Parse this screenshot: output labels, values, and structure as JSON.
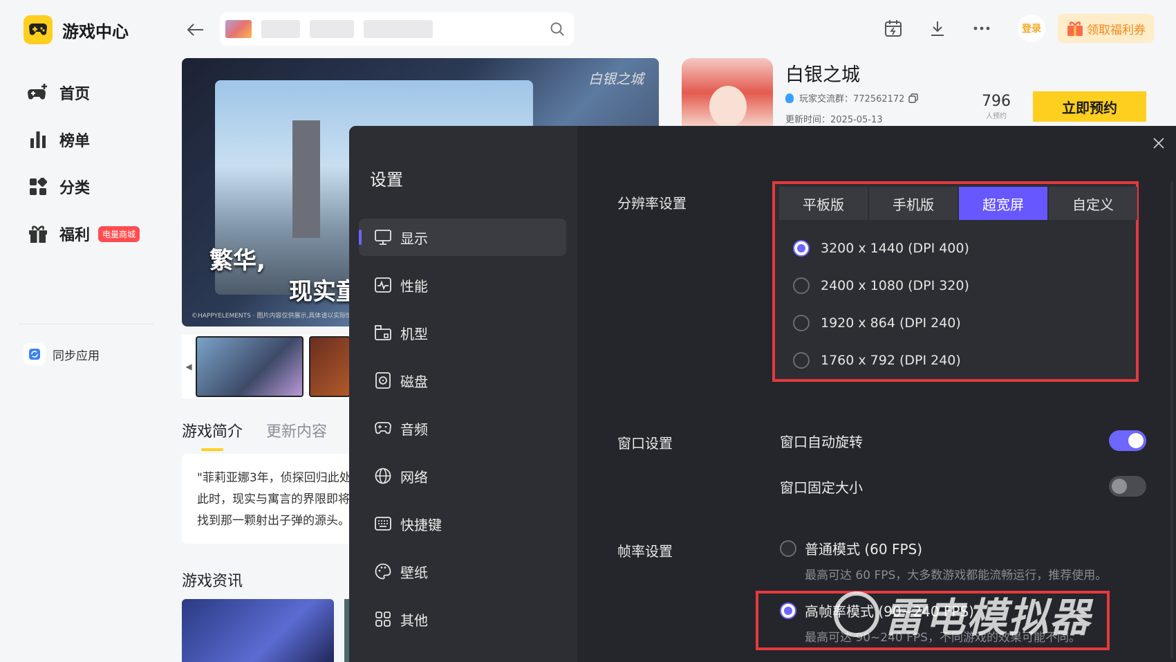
{
  "app": {
    "title": "游戏中心"
  },
  "nav": [
    {
      "label": "首页",
      "icon": "gamepad-plus-icon"
    },
    {
      "label": "榜单",
      "icon": "bar-chart-icon"
    },
    {
      "label": "分类",
      "icon": "grid-icon"
    },
    {
      "label": "福利",
      "icon": "gift-icon",
      "badge": "电量商城"
    }
  ],
  "sync": {
    "label": "同步应用"
  },
  "topbar": {
    "login": "登录",
    "welfare": "领取福利券"
  },
  "banner": {
    "title1": "繁华,",
    "title2": "现实童",
    "logo": "白银之城",
    "copyright": "©HAPPYELEMENTS · 图片内容仅供展示,具体请以实际情况为准"
  },
  "game": {
    "name": "白银之城",
    "qq_group": "玩家交流群：772562172",
    "updated": "更新时间：2025-05-13",
    "reservations": "796",
    "reservations_label": "人预约",
    "reserve_button": "立即预约"
  },
  "game_tabs": {
    "intro": "游戏简介",
    "updates": "更新内容"
  },
  "description": {
    "line1": "\"菲莉亚娜3年，侦探回归此处",
    "line2": "此时，现实与寓言的界限即将",
    "line3": "找到那一颗射出子弹的源头。"
  },
  "news": {
    "title": "游戏资讯"
  },
  "settings": {
    "title": "设置",
    "menu": [
      {
        "label": "显示",
        "icon": "monitor-icon",
        "active": true
      },
      {
        "label": "性能",
        "icon": "performance-icon"
      },
      {
        "label": "机型",
        "icon": "device-model-icon"
      },
      {
        "label": "磁盘",
        "icon": "disk-icon"
      },
      {
        "label": "音频",
        "icon": "audio-gamepad-icon"
      },
      {
        "label": "网络",
        "icon": "globe-icon"
      },
      {
        "label": "快捷键",
        "icon": "keyboard-icon"
      },
      {
        "label": "壁纸",
        "icon": "palette-icon"
      },
      {
        "label": "其他",
        "icon": "apps-grid-icon"
      }
    ],
    "resolution": {
      "label": "分辨率设置",
      "tabs": [
        "平板版",
        "手机版",
        "超宽屏",
        "自定义"
      ],
      "active_tab": "超宽屏",
      "options": [
        {
          "text": "3200 x 1440 (DPI 400)",
          "selected": true
        },
        {
          "text": "2400 x 1080 (DPI 320)",
          "selected": false
        },
        {
          "text": "1920 x 864 (DPI 240)",
          "selected": false
        },
        {
          "text": "1760 x 792 (DPI 240)",
          "selected": false
        }
      ]
    },
    "window": {
      "label": "窗口设置",
      "auto_rotate": {
        "label": "窗口自动旋转",
        "on": true
      },
      "fixed_size": {
        "label": "窗口固定大小",
        "on": false
      }
    },
    "fps": {
      "label": "帧率设置",
      "normal": {
        "label": "普通模式 (60 FPS)",
        "desc": "最高可达 60 FPS，大多数游戏都能流畅运行，推荐使用。",
        "selected": false
      },
      "high": {
        "label": "高帧率模式 (90~240 FPS)",
        "desc": "最高可达 90~240 FPS，不同游戏的效果可能不同。",
        "selected": true
      }
    }
  },
  "watermark": "雷电模拟器",
  "colors": {
    "accent": "#6d66ff",
    "highlight_border": "#e5393d",
    "brand_yellow": "#ffcf1f"
  }
}
